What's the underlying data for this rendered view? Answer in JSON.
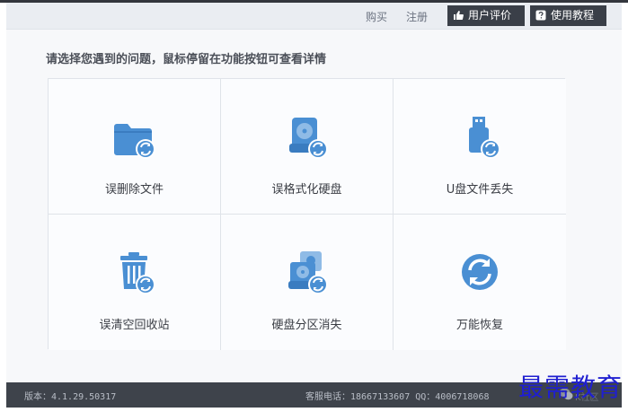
{
  "topbar": {
    "buy_label": "购买",
    "register_label": "注册",
    "review_label": "用户评价",
    "tutorial_label": "使用教程"
  },
  "prompt": "请选择您遇到的问题，鼠标停留在功能按钮可查看详情",
  "options": [
    {
      "label": "误删除文件",
      "icon": "folder-recover-icon"
    },
    {
      "label": "误格式化硬盘",
      "icon": "harddisk-recover-icon"
    },
    {
      "label": "U盘文件丢失",
      "icon": "usb-drive-recover-icon"
    },
    {
      "label": "误清空回收站",
      "icon": "recycle-bin-recover-icon"
    },
    {
      "label": "硬盘分区消失",
      "icon": "disk-partition-recover-icon"
    },
    {
      "label": "万能恢复",
      "icon": "universal-recover-icon"
    }
  ],
  "footer": {
    "version": "版本：4.1.29.50317",
    "contact": "客服电话：18667133607 QQ：4006718068"
  },
  "watermark": {
    "social_text": "K社区",
    "overlay": "最需教育"
  },
  "colors": {
    "icon_blue": "#4a8fd3",
    "footer_bg": "#3e434b",
    "topbar_bg": "#eaedf2"
  }
}
